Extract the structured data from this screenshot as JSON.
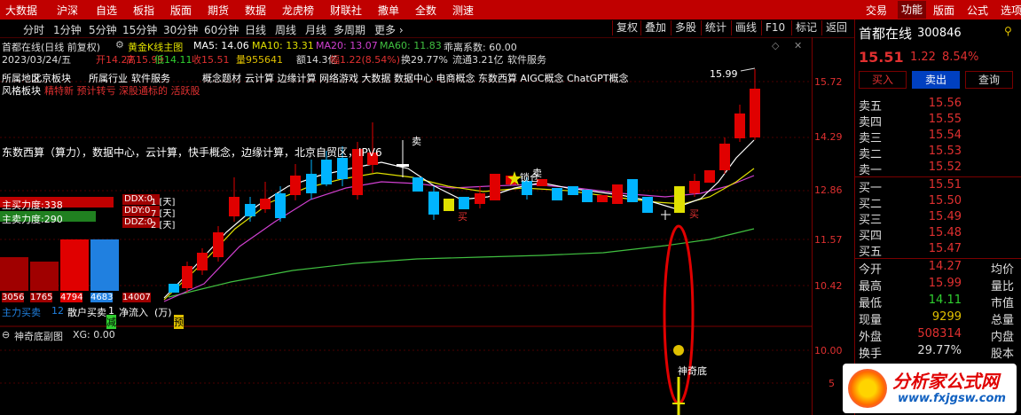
{
  "topbar": {
    "left_items": [
      "大数据",
      "沪深",
      "自选",
      "板指",
      "版面",
      "期货",
      "数据",
      "龙虎榜",
      "财联社",
      "撒单",
      "全数",
      "测速"
    ],
    "right_items": [
      "交易",
      "功能",
      "版面",
      "公式",
      "选项"
    ],
    "active_right": "功能"
  },
  "period_bar": {
    "items": [
      "分时",
      "1分钟",
      "5分钟",
      "15分钟",
      "30分钟",
      "60分钟",
      "日线",
      "周线",
      "月线",
      "多周期",
      "更多 ›"
    ],
    "active": "日线"
  },
  "toolbar": {
    "buttons": [
      "复权",
      "叠加",
      "多股",
      "统计",
      "画线",
      "F10",
      "标记",
      "返回"
    ]
  },
  "main_info": {
    "title": "首都在线(日线 前复权)",
    "indicator": "黄金K线主图",
    "ma5": "MA5: 14.06",
    "ma10": "MA10: 13.31",
    "ma20": "MA20: 13.07",
    "ma60": "MA60: 11.83",
    "factor": "乖离系数: 60.00",
    "date": "2023/03/24/五",
    "open": "开14.27",
    "high": "高15.99",
    "low": "低14.11",
    "close": "收15.51",
    "volume": "量955641",
    "amount": "额14.3亿",
    "change": "幅1.22(8.54%)",
    "turnover": "换29.77%",
    "float_cap": "流通3.21亿",
    "software": "软件服务"
  },
  "concepts": {
    "line1_a": "所属地区",
    "line1_b": "北京板块",
    "line1_c": "所属行业",
    "line1_d": "软件服务",
    "line1_e": "概念题材",
    "line1_f": "云计算 边缘计算 网络游戏 大数据 数据中心 电商概念 东数西算 AIGC概念 ChatGPT概念",
    "style_label": "风格板块",
    "style_value": "精特新 预计转亏 深股通标的 活跃股",
    "description": "东数西算（算力），数据中心，云计算，快手概念，边缘计算，北京自贸区，IPV6"
  },
  "annotations": {
    "peak": "15.99",
    "sell1": "卖",
    "sell2": "卖",
    "buy1": "买",
    "buy2": "买",
    "lock": "锁仓",
    "pre": "预",
    "reduce": "减",
    "sub_signal": "神奇底"
  },
  "left_panel": {
    "buy_force": "主买力度:338",
    "sell_force": "主卖力度:290",
    "ddx": "DDX:0",
    "ddy": "DDY:0",
    "ddz": "DDZ:0",
    "ddx_suffix": "1 [天]",
    "ddy_suffix": "7 [天]",
    "ddz_suffix": "2 [天]",
    "bottom_numbers": [
      "3056",
      "1765",
      "4794",
      "4683",
      "14007"
    ],
    "main_buy_label": "主力买卖",
    "main_buy_value": "12",
    "shortcut": "散户买卖",
    "net_inflow": "净流入",
    "unit": "(万)",
    "net_value": "1"
  },
  "sub_chart": {
    "title": "神奇底副图",
    "xg": "XG: 0.00",
    "axis": [
      "10.00",
      "5"
    ]
  },
  "price_axis": [
    "15.72",
    "14.29",
    "12.86",
    "11.57",
    "10.42"
  ],
  "quote_panel": {
    "name": "首都在线",
    "code": "300846",
    "price": "15.51",
    "change": "1.22",
    "pct": "8.54%",
    "buttons": [
      "买入",
      "卖出",
      "查询"
    ],
    "asks": [
      {
        "label": "卖五",
        "price": "15.56"
      },
      {
        "label": "卖四",
        "price": "15.55"
      },
      {
        "label": "卖三",
        "price": "15.54"
      },
      {
        "label": "卖二",
        "price": "15.53"
      },
      {
        "label": "卖一",
        "price": "15.52"
      }
    ],
    "bids": [
      {
        "label": "买一",
        "price": "15.51"
      },
      {
        "label": "买二",
        "price": "15.50"
      },
      {
        "label": "买三",
        "price": "15.49"
      },
      {
        "label": "买四",
        "price": "15.48"
      },
      {
        "label": "买五",
        "price": "15.47"
      }
    ],
    "stats": [
      {
        "l": "今开",
        "v": "14.27",
        "r": "均价",
        "c": "#e03030"
      },
      {
        "l": "最高",
        "v": "15.99",
        "r": "量比",
        "c": "#e03030"
      },
      {
        "l": "最低",
        "v": "14.11",
        "r": "市值",
        "c": "#30d030"
      },
      {
        "l": "现量",
        "v": "9299",
        "r": "总量",
        "c": "#e0c000"
      },
      {
        "l": "外盘",
        "v": "508314",
        "r": "内盘",
        "c": "#e03030"
      },
      {
        "l": "换手",
        "v": "29.77%",
        "r": "股本",
        "c": "#ddd"
      }
    ]
  },
  "watermark": {
    "brand": "分析家公式网",
    "url": "www.fxjgsw.com"
  },
  "colors": {
    "up": "#e00000",
    "down": "#00b4ff",
    "accent": "#c00000",
    "ma5": "#ffffff",
    "ma10": "#e0e000",
    "ma20": "#d040d0",
    "ma60": "#40c040"
  }
}
